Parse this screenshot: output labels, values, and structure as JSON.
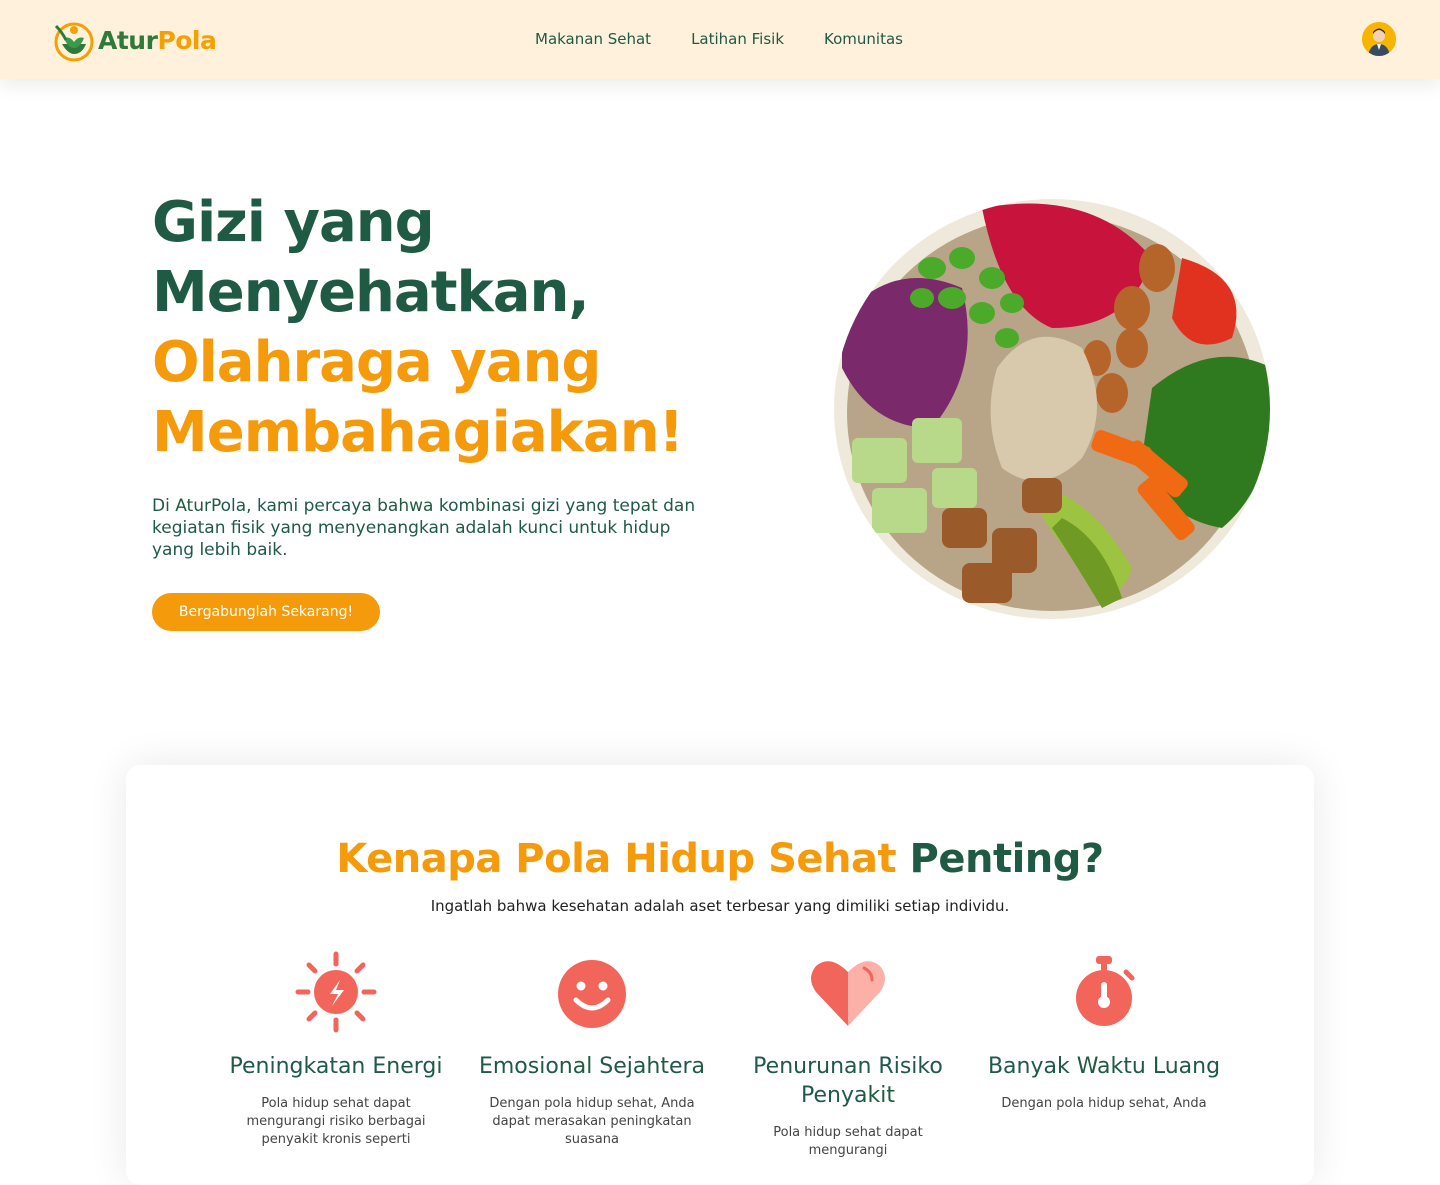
{
  "brand": {
    "name_part1": "Atur",
    "name_part2": "Pola"
  },
  "nav": {
    "items": [
      {
        "label": "Makanan Sehat"
      },
      {
        "label": "Latihan Fisik"
      },
      {
        "label": "Komunitas"
      }
    ]
  },
  "hero": {
    "title_line1": "Gizi yang",
    "title_line2": "Menyehatkan,",
    "title_line3": "Olahraga yang",
    "title_line4": "Membahagiakan!",
    "description": "Di AturPola, kami percaya bahwa kombinasi gizi yang tepat dan kegiatan fisik yang menyenangkan adalah kunci untuk hidup yang lebih baik.",
    "cta_label": "Bergabunglah Sekarang!"
  },
  "why": {
    "title_orange": "Kenapa Pola Hidup Sehat",
    "title_dark": "Penting?",
    "subtitle": "Ingatlah bahwa kesehatan adalah aset terbesar yang dimiliki setiap individu.",
    "features": [
      {
        "title": "Peningkatan Energi",
        "desc": "Pola hidup sehat dapat mengurangi risiko berbagai penyakit kronis seperti",
        "icon": "energy-sun-icon"
      },
      {
        "title": "Emosional Sejahtera",
        "desc": "Dengan pola hidup sehat, Anda dapat merasakan peningkatan suasana",
        "icon": "smile-icon"
      },
      {
        "title": "Penurunan Risiko Penyakit",
        "desc": "Pola hidup sehat dapat mengurangi",
        "icon": "heart-icon"
      },
      {
        "title": "Banyak Waktu Luang",
        "desc": "Dengan pola hidup sehat, Anda",
        "icon": "stopwatch-icon"
      }
    ]
  },
  "colors": {
    "primary_dark": "#1f5a44",
    "accent_orange": "#f59a0a",
    "icon_coral": "#f2655a",
    "nav_bg": "#fff1dc"
  }
}
